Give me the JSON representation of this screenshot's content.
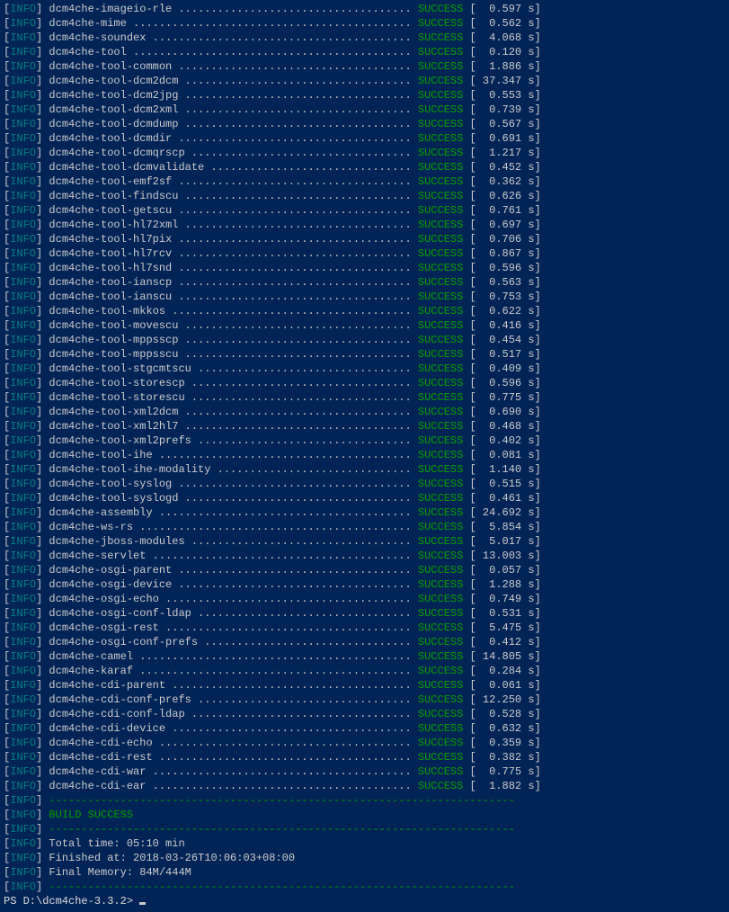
{
  "tag": "INFO",
  "status": "SUCCESS",
  "build": "BUILD SUCCESS",
  "summary": {
    "total_time": "Total time: 05:10 min",
    "finished_at": "Finished at: 2018-03-26T10:06:03+08:00",
    "final_memory": "Final Memory: 84M/444M"
  },
  "prompt": "PS D:\\dcm4che-3.3.2> ",
  "separator_len": 72,
  "name_col_width": 56,
  "modules": [
    {
      "name": "dcm4che-imageio-rle",
      "time": "0.597"
    },
    {
      "name": "dcm4che-mime",
      "time": "0.562"
    },
    {
      "name": "dcm4che-soundex",
      "time": "4.068"
    },
    {
      "name": "dcm4che-tool",
      "time": "0.120"
    },
    {
      "name": "dcm4che-tool-common",
      "time": "1.886"
    },
    {
      "name": "dcm4che-tool-dcm2dcm",
      "time": "37.347"
    },
    {
      "name": "dcm4che-tool-dcm2jpg",
      "time": "0.553"
    },
    {
      "name": "dcm4che-tool-dcm2xml",
      "time": "0.739"
    },
    {
      "name": "dcm4che-tool-dcmdump",
      "time": "0.567"
    },
    {
      "name": "dcm4che-tool-dcmdir",
      "time": "0.691"
    },
    {
      "name": "dcm4che-tool-dcmqrscp",
      "time": "1.217"
    },
    {
      "name": "dcm4che-tool-dcmvalidate",
      "time": "0.452"
    },
    {
      "name": "dcm4che-tool-emf2sf",
      "time": "0.362"
    },
    {
      "name": "dcm4che-tool-findscu",
      "time": "0.626"
    },
    {
      "name": "dcm4che-tool-getscu",
      "time": "0.761"
    },
    {
      "name": "dcm4che-tool-hl72xml",
      "time": "0.697"
    },
    {
      "name": "dcm4che-tool-hl7pix",
      "time": "0.706"
    },
    {
      "name": "dcm4che-tool-hl7rcv",
      "time": "0.867"
    },
    {
      "name": "dcm4che-tool-hl7snd",
      "time": "0.596"
    },
    {
      "name": "dcm4che-tool-ianscp",
      "time": "0.563"
    },
    {
      "name": "dcm4che-tool-ianscu",
      "time": "0.753"
    },
    {
      "name": "dcm4che-tool-mkkos",
      "time": "0.622"
    },
    {
      "name": "dcm4che-tool-movescu",
      "time": "0.416"
    },
    {
      "name": "dcm4che-tool-mppsscp",
      "time": "0.454"
    },
    {
      "name": "dcm4che-tool-mppsscu",
      "time": "0.517"
    },
    {
      "name": "dcm4che-tool-stgcmtscu",
      "time": "0.409"
    },
    {
      "name": "dcm4che-tool-storescp",
      "time": "0.596"
    },
    {
      "name": "dcm4che-tool-storescu",
      "time": "0.775"
    },
    {
      "name": "dcm4che-tool-xml2dcm",
      "time": "0.690"
    },
    {
      "name": "dcm4che-tool-xml2hl7",
      "time": "0.468"
    },
    {
      "name": "dcm4che-tool-xml2prefs",
      "time": "0.402"
    },
    {
      "name": "dcm4che-tool-ihe",
      "time": "0.081"
    },
    {
      "name": "dcm4che-tool-ihe-modality",
      "time": "1.140"
    },
    {
      "name": "dcm4che-tool-syslog",
      "time": "0.515"
    },
    {
      "name": "dcm4che-tool-syslogd",
      "time": "0.461"
    },
    {
      "name": "dcm4che-assembly",
      "time": "24.692"
    },
    {
      "name": "dcm4che-ws-rs",
      "time": "5.854"
    },
    {
      "name": "dcm4che-jboss-modules",
      "time": "5.017"
    },
    {
      "name": "dcm4che-servlet",
      "time": "13.003"
    },
    {
      "name": "dcm4che-osgi-parent",
      "time": "0.057"
    },
    {
      "name": "dcm4che-osgi-device",
      "time": "1.288"
    },
    {
      "name": "dcm4che-osgi-echo",
      "time": "0.749"
    },
    {
      "name": "dcm4che-osgi-conf-ldap",
      "time": "0.531"
    },
    {
      "name": "dcm4che-osgi-rest",
      "time": "5.475"
    },
    {
      "name": "dcm4che-osgi-conf-prefs",
      "time": "0.412"
    },
    {
      "name": "dcm4che-camel",
      "time": "14.805"
    },
    {
      "name": "dcm4che-karaf",
      "time": "0.284"
    },
    {
      "name": "dcm4che-cdi-parent",
      "time": "0.061"
    },
    {
      "name": "dcm4che-cdi-conf-prefs",
      "time": "12.250"
    },
    {
      "name": "dcm4che-cdi-conf-ldap",
      "time": "0.528"
    },
    {
      "name": "dcm4che-cdi-device",
      "time": "0.632"
    },
    {
      "name": "dcm4che-cdi-echo",
      "time": "0.359"
    },
    {
      "name": "dcm4che-cdi-rest",
      "time": "0.382"
    },
    {
      "name": "dcm4che-cdi-war",
      "time": "0.775"
    },
    {
      "name": "dcm4che-cdi-ear",
      "time": "1.882"
    }
  ]
}
